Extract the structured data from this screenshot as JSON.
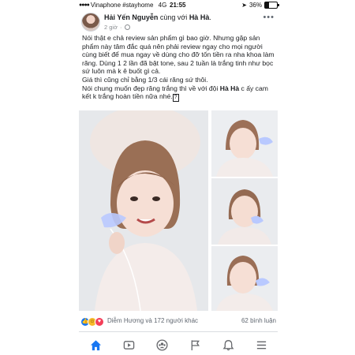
{
  "status_bar": {
    "carrier": "Vinaphone #stayhome",
    "network": "4G",
    "time": "21:55",
    "battery": "36%",
    "battery_level": 0.36
  },
  "post": {
    "author": "Hải Yến Nguyễn",
    "with_text": "cùng với",
    "tagged": "Hà Hà",
    "time": "2 giờ",
    "paragraphs": [
      "Nói thật e chả review sản phẩm gì bao giờ. Nhưng gặp sản phẩm này tâm đắc quá nên phải review ngay cho mọi người cùng biết để mua ngay về dùng cho đỡ tốn tiền ra nha khoa làm răng. Dùng 1 2 lần đã bật tone, sau 2 tuần là trắng tinh như bọc sứ luôn mà k ê buốt gì cả.",
      "Giá thì cũng chỉ bằng 1/3 cái răng sứ thôi."
    ],
    "last_line_start": "Nói chung muốn đẹp răng trắng thì về với đội",
    "last_line_tag": "Hà Hà",
    "last_line_end": "c ấy cam kết k trắng hoàn tiền nữa nhé.",
    "emoji_box": "?"
  },
  "reactions": {
    "who": "Diễm Hương và 172 người khác",
    "comments": "62 bình luận"
  },
  "icons": {
    "more": "more-icon",
    "privacy": "globe-icon",
    "tabs": [
      "home-icon",
      "watch-icon",
      "groups-icon",
      "pages-icon",
      "notifications-icon",
      "menu-icon"
    ]
  },
  "colors": {
    "accent": "#1877f2",
    "text": "#1c1e21",
    "muted": "#606770",
    "tab_inactive": "#65676b"
  }
}
